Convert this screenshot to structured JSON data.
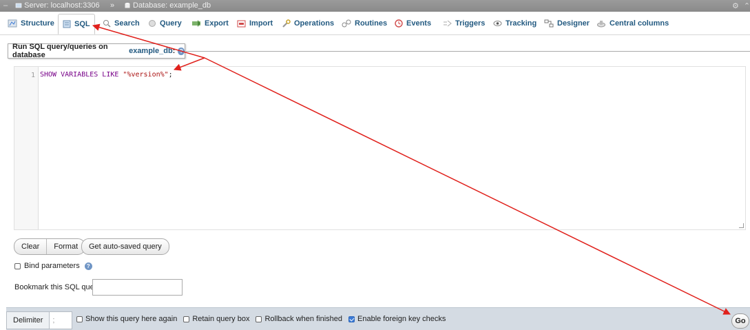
{
  "breadcrumb": {
    "server": "Server: localhost:3306",
    "separator": "»",
    "database": "Database: example_db"
  },
  "tabs": [
    {
      "label": "Structure",
      "icon": "structure-icon"
    },
    {
      "label": "SQL",
      "icon": "sql-icon",
      "active": true
    },
    {
      "label": "Search",
      "icon": "search-icon"
    },
    {
      "label": "Query",
      "icon": "query-icon"
    },
    {
      "label": "Export",
      "icon": "export-icon"
    },
    {
      "label": "Import",
      "icon": "import-icon"
    },
    {
      "label": "Operations",
      "icon": "wrench-icon"
    },
    {
      "label": "Routines",
      "icon": "routines-icon"
    },
    {
      "label": "Events",
      "icon": "clock-icon"
    },
    {
      "label": "Triggers",
      "icon": "triggers-icon"
    },
    {
      "label": "Tracking",
      "icon": "eye-icon"
    },
    {
      "label": "Designer",
      "icon": "designer-icon"
    },
    {
      "label": "Central columns",
      "icon": "central-columns-icon"
    }
  ],
  "query_panel": {
    "legend_prefix": "Run SQL query/queries on database",
    "db_link": "example_db",
    "legend_suffix": ":",
    "line_number": "1",
    "sql_keyword": "SHOW VARIABLES LIKE",
    "sql_string": "\"%version%\"",
    "sql_end": ";"
  },
  "buttons": {
    "clear": "Clear",
    "format": "Format",
    "auto_saved": "Get auto-saved query",
    "go": "Go"
  },
  "bind_parameters": {
    "label": "Bind parameters",
    "checked": false
  },
  "bookmark": {
    "label": "Bookmark this SQL query:",
    "value": ""
  },
  "footer": {
    "delimiter_label": "Delimiter",
    "delimiter_value": ";",
    "options": [
      {
        "label": "Show this query here again",
        "checked": false
      },
      {
        "label": "Retain query box",
        "checked": false
      },
      {
        "label": "Rollback when finished",
        "checked": false
      },
      {
        "label": "Enable foreign key checks",
        "checked": true
      }
    ]
  },
  "colors": {
    "link": "#235a81",
    "annotation_arrow": "#e0201b",
    "footer_bg": "#d4dbe3"
  }
}
